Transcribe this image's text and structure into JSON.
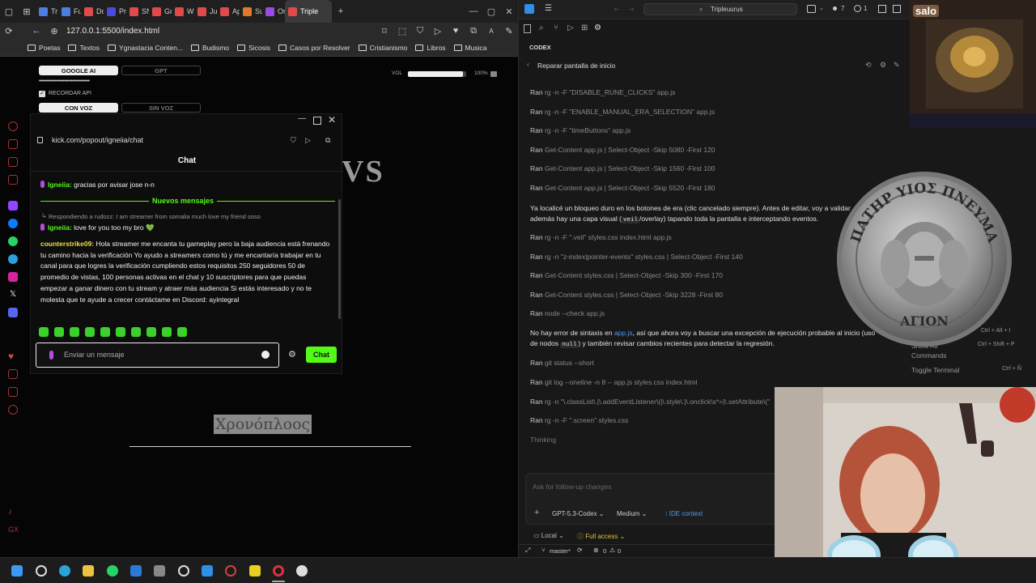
{
  "browser": {
    "tabs": [
      {
        "label": "Tr",
        "color": "#4a7ee0"
      },
      {
        "label": "Fu",
        "color": "#4a7ee0"
      },
      {
        "label": "Do",
        "color": "#e04a4a"
      },
      {
        "label": "Pr",
        "color": "#4a4ae0"
      },
      {
        "label": "SN",
        "color": "#e04a4a"
      },
      {
        "label": "Gr",
        "color": "#e04a4a"
      },
      {
        "label": "Wi",
        "color": "#e04a4a"
      },
      {
        "label": "Ju",
        "color": "#e04a4a"
      },
      {
        "label": "Ap",
        "color": "#e04a4a"
      },
      {
        "label": "Su",
        "color": "#e07a2a"
      },
      {
        "label": "On",
        "color": "#9a4ae0"
      },
      {
        "label": "Triple",
        "color": "#e04a4a"
      }
    ],
    "url": "127.0.0.1:5500/index.html",
    "bookmarks": [
      "Poetas",
      "Textos",
      "Ygnastacia Conten...",
      "Budismo",
      "Sicosis",
      "Casos por Resolver",
      "Cristianismo",
      "Libros",
      "Musica"
    ]
  },
  "app": {
    "google_ai": "GOOGLE AI",
    "gpt": "GPT",
    "api_mask": "••••••••••••••••••••••••••••••••",
    "remember_api": "RECORDAR API",
    "con_voz": "CON VOZ",
    "sin_voz": "SIN VOZ",
    "vol_label": "VOL",
    "vol_percent": "100%",
    "vol_level": 0.95,
    "vs_text": "VS",
    "title_greek": "Χρονόπλοος"
  },
  "chat": {
    "url": "kick.com/popout/igneiia/chat",
    "header": "Chat",
    "first_user": "Igneiia:",
    "first_text": "gracias por avisar jose n-n",
    "new_messages": "Nuevos mensajes",
    "reply_to": "Respondiendo a rudozz: I am streamer from somalia much love my friend soso",
    "second_user": "Igneiia:",
    "second_text": "love for you too my bro 💚",
    "third_user": "counterstrike09:",
    "third_text": "Hola streamer me encanta tu gameplay pero la baja audiencia está frenando tu camino hacia la verificación Yo ayudo a streamers como tú y me encantaría trabajar en tu canal para que logres la verificación cumpliendo estos requisitos 250 seguidores 50 de promedio de vistas, 100 personas activas en el chat y 10 suscriptores para que puedas empezar a ganar dinero con tu stream y atraer más audiencia Si estás interesado y no te molesta que te ayude a crecer contáctame en Discord: ayintegral",
    "input_placeholder": "Enviar un mensaje",
    "send_label": "Chat"
  },
  "vscode": {
    "search": "Tripleuurus",
    "badge_a": "7",
    "badge_b": "1",
    "panel_title": "CODEX",
    "thread_title": "Reparar pantalla de inicio",
    "ran": "Ran",
    "commands": [
      "rg -n -F \"DISABLE_RUNE_CLICKS\" app.js",
      "rg -n -F \"ENABLE_MANUAL_ERA_SELECTION\" app.js",
      "rg -n -F \"timeButtons\" app.js",
      "Get-Content app.js | Select-Object -Skip 5080 -First 120",
      "Get-Content app.js | Select-Object -Skip 1560 -First 100",
      "Get-Content app.js | Select-Object -Skip 5520 -First 180"
    ],
    "para1_a": "Ya localicé un bloqueo duro en los botones de era (clic cancelado siempre). Antes de editar, voy a validar",
    "para1_b": "además hay una capa visual (",
    "para1_code": "veil",
    "para1_c": "/overlay) tapando toda la pantalla e interceptando eventos.",
    "commands2": [
      "rg -n -F \".veil\" styles.css index.html app.js",
      "rg -n \"z-index|pointer-events\" styles.css | Select-Object -First 140",
      "Get-Content styles.css | Select-Object -Skip 300 -First 170",
      "Get-Content styles.css | Select-Object -Skip 3228 -First 80",
      "node --check app.js"
    ],
    "para2_a": "No hay error de sintaxis en ",
    "para2_link": "app.js",
    "para2_b": ", así que ahora voy a buscar una excepción de ejecución probable al inicio (uso",
    "para2_c": "de nodos ",
    "para2_code": "null",
    "para2_d": ") y también revisar cambios recientes para detectar la regresión.",
    "commands3": [
      "git status --short",
      "git log --oneline -n 8 -- app.js styles.css index.html",
      "rg -n \"\\.classList\\.|\\.addEventListener\\(|\\.style\\.|\\.onclick\\s*=|\\.setAttribute\\(\"",
      "rg -n -F \".screen\" styles.css"
    ],
    "thinking": "Thinking",
    "followup_placeholder": "Ask for follow-up changes",
    "model": "GPT-5.3-Codex",
    "effort": "Medium",
    "ide_context": "IDE context",
    "local": "Local",
    "access": "Full access",
    "branch": "master*",
    "errors": "0",
    "warnings": "0"
  },
  "right": {
    "salo": "salo",
    "shortcut1_keys": [
      "Ctrl",
      "+",
      "Alt",
      "+",
      "I"
    ],
    "show_all": "Show All",
    "commands_label": "Commands",
    "shortcut2_keys": [
      "Ctrl",
      "+",
      "Shift",
      "+",
      "P"
    ],
    "toggle_terminal": "Toggle Terminal",
    "shortcut3_keys": [
      "Ctrl",
      "+",
      "Ñ"
    ],
    "coin_top": "ΠΑΤΗΡ ΥΙΟΣ ΠΝΕΥΜΑ",
    "coin_bottom": "ΑΓΙΟΝ"
  },
  "colors": {
    "kick_green": "#53fc18",
    "link_blue": "#4d9cf0",
    "accent_red": "#e04a4a"
  }
}
